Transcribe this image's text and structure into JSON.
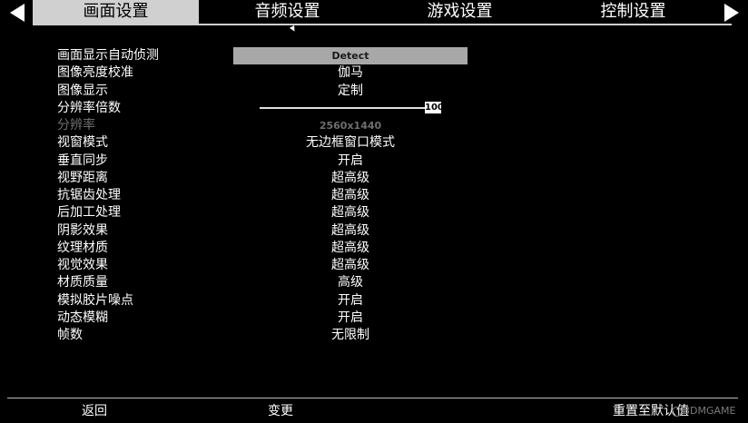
{
  "tabs": [
    {
      "label": "画面设置",
      "active": true
    },
    {
      "label": "音频设置",
      "active": false
    },
    {
      "label": "游戏设置",
      "active": false
    },
    {
      "label": "控制设置",
      "active": false
    }
  ],
  "settings": [
    {
      "label": "画面显示自动侦测",
      "value": "Detect",
      "state": "highlighted"
    },
    {
      "label": "图像亮度校准",
      "value": "伽马"
    },
    {
      "label": "图像显示",
      "value": "定制"
    },
    {
      "label": "分辨率倍数",
      "value": "100",
      "control": "slider",
      "level": 1.0
    },
    {
      "label": "分辨率",
      "value": "2560x1440",
      "state": "disabled"
    },
    {
      "label": "视窗模式",
      "value": "无边框窗口模式"
    },
    {
      "label": "垂直同步",
      "value": "开启"
    },
    {
      "label": "视野距离",
      "value": "超高级"
    },
    {
      "label": "抗锯齿处理",
      "value": "超高级"
    },
    {
      "label": "后加工处理",
      "value": "超高级"
    },
    {
      "label": "阴影效果",
      "value": "超高级"
    },
    {
      "label": "纹理材质",
      "value": "超高级"
    },
    {
      "label": "视觉效果",
      "value": "超高级"
    },
    {
      "label": "材质质量",
      "value": "高级"
    },
    {
      "label": "模拟胶片噪点",
      "value": "开启"
    },
    {
      "label": "动态模糊",
      "value": "开启"
    },
    {
      "label": "帧数",
      "value": "无限制"
    }
  ],
  "footer": {
    "back": "返回",
    "change": "变更",
    "reset": "重置至默认值"
  },
  "watermark": "3DMGAME"
}
